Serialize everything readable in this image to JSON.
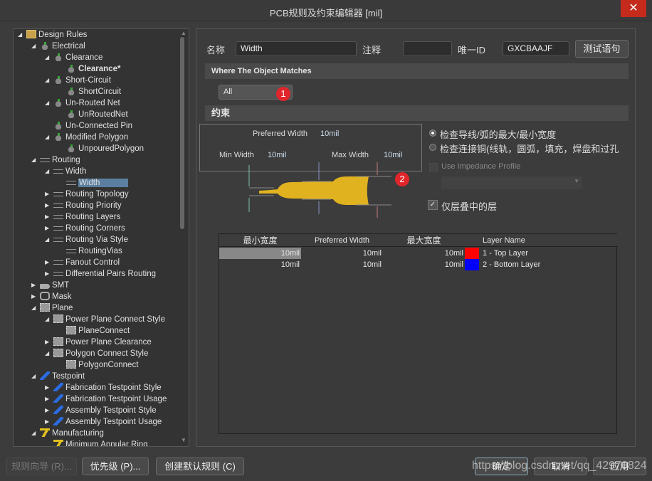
{
  "window": {
    "title": "PCB规则及约束编辑器 [mil]",
    "close_icon": "close-icon"
  },
  "tree": [
    {
      "label": "Design Rules",
      "level": 0,
      "state": "open",
      "icon": "folder"
    },
    {
      "label": "Electrical",
      "level": 1,
      "state": "open",
      "icon": "electrical"
    },
    {
      "label": "Clearance",
      "level": 2,
      "state": "open",
      "icon": "electrical"
    },
    {
      "label": "Clearance*",
      "level": 3,
      "state": "leaf",
      "icon": "electrical",
      "bold": true
    },
    {
      "label": "Short-Circuit",
      "level": 2,
      "state": "open",
      "icon": "electrical"
    },
    {
      "label": "ShortCircuit",
      "level": 3,
      "state": "leaf",
      "icon": "electrical"
    },
    {
      "label": "Un-Routed Net",
      "level": 2,
      "state": "open",
      "icon": "electrical"
    },
    {
      "label": "UnRoutedNet",
      "level": 3,
      "state": "leaf",
      "icon": "electrical"
    },
    {
      "label": "Un-Connected Pin",
      "level": 2,
      "state": "leaf",
      "icon": "electrical"
    },
    {
      "label": "Modified Polygon",
      "level": 2,
      "state": "open",
      "icon": "electrical"
    },
    {
      "label": "UnpouredPolygon",
      "level": 3,
      "state": "leaf",
      "icon": "electrical"
    },
    {
      "label": "Routing",
      "level": 1,
      "state": "open",
      "icon": "routing"
    },
    {
      "label": "Width",
      "level": 2,
      "state": "open",
      "icon": "routing"
    },
    {
      "label": "Width",
      "level": 3,
      "state": "leaf",
      "icon": "routing",
      "selected": true
    },
    {
      "label": "Routing Topology",
      "level": 2,
      "state": "closed",
      "icon": "routing"
    },
    {
      "label": "Routing Priority",
      "level": 2,
      "state": "closed",
      "icon": "routing"
    },
    {
      "label": "Routing Layers",
      "level": 2,
      "state": "closed",
      "icon": "routing"
    },
    {
      "label": "Routing Corners",
      "level": 2,
      "state": "closed",
      "icon": "routing"
    },
    {
      "label": "Routing Via Style",
      "level": 2,
      "state": "open",
      "icon": "routing"
    },
    {
      "label": "RoutingVias",
      "level": 3,
      "state": "leaf",
      "icon": "routing"
    },
    {
      "label": "Fanout Control",
      "level": 2,
      "state": "closed",
      "icon": "routing"
    },
    {
      "label": "Differential Pairs Routing",
      "level": 2,
      "state": "closed",
      "icon": "routing"
    },
    {
      "label": "SMT",
      "level": 1,
      "state": "closed",
      "icon": "smt"
    },
    {
      "label": "Mask",
      "level": 1,
      "state": "closed",
      "icon": "mask"
    },
    {
      "label": "Plane",
      "level": 1,
      "state": "open",
      "icon": "plane"
    },
    {
      "label": "Power Plane Connect Style",
      "level": 2,
      "state": "open",
      "icon": "plane"
    },
    {
      "label": "PlaneConnect",
      "level": 3,
      "state": "leaf",
      "icon": "plane"
    },
    {
      "label": "Power Plane Clearance",
      "level": 2,
      "state": "closed",
      "icon": "plane"
    },
    {
      "label": "Polygon Connect Style",
      "level": 2,
      "state": "open",
      "icon": "plane"
    },
    {
      "label": "PolygonConnect",
      "level": 3,
      "state": "leaf",
      "icon": "plane"
    },
    {
      "label": "Testpoint",
      "level": 1,
      "state": "open",
      "icon": "testpoint"
    },
    {
      "label": "Fabrication Testpoint Style",
      "level": 2,
      "state": "closed",
      "icon": "testpoint"
    },
    {
      "label": "Fabrication Testpoint Usage",
      "level": 2,
      "state": "closed",
      "icon": "testpoint"
    },
    {
      "label": "Assembly Testpoint Style",
      "level": 2,
      "state": "closed",
      "icon": "testpoint"
    },
    {
      "label": "Assembly Testpoint Usage",
      "level": 2,
      "state": "closed",
      "icon": "testpoint"
    },
    {
      "label": "Manufacturing",
      "level": 1,
      "state": "open",
      "icon": "manufacturing"
    },
    {
      "label": "Minimum Annular Ring",
      "level": 2,
      "state": "leaf",
      "icon": "manufacturing"
    }
  ],
  "form": {
    "name_label": "名称",
    "name_value": "Width",
    "comment_label": "注释",
    "comment_value": "",
    "uid_label": "唯一ID",
    "uid_value": "GXCBAAJF",
    "test_button": "测试语句"
  },
  "match": {
    "header": "Where The Object Matches",
    "dropdown_value": "All",
    "badge": "1"
  },
  "constraints": {
    "header": "约束",
    "preferred_label": "Preferred Width",
    "preferred_value": "10mil",
    "min_label": "Min Width",
    "min_value": "10mil",
    "max_label": "Max Width",
    "max_value": "10mil",
    "badge": "2",
    "radio1": "检查导线/弧的最大/最小宽度",
    "radio2": "检查连接铜(线轨，圆弧，填充，焊盘和过孔",
    "radio_selected": 1,
    "impedance_label": "Use Impedance Profile",
    "impedance_checked": false,
    "layer_stack_label": "仅层叠中的层",
    "layer_stack_checked": true
  },
  "table": {
    "headers": [
      "最小宽度",
      "Preferred Width",
      "最大宽度",
      "Layer Name"
    ],
    "rows": [
      {
        "min": "10mil",
        "pref": "10mil",
        "max": "10mil",
        "color": "#ff0000",
        "layer": "1 - Top Layer"
      },
      {
        "min": "10mil",
        "pref": "10mil",
        "max": "10mil",
        "color": "#0000ff",
        "layer": "2 - Bottom Layer"
      }
    ]
  },
  "footer": {
    "wizard": "规则向导 (R)...",
    "priority": "优先级 (P)...",
    "create_default": "创建默认规则 (C)",
    "ok": "确定",
    "cancel": "取消",
    "apply": "应用",
    "watermark": "https://blog.csdn.net/qq_42970824"
  }
}
